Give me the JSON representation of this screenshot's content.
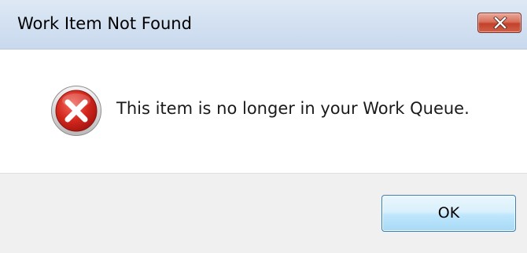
{
  "window": {
    "title": "Work Item Not Found",
    "close_icon": "close-x-icon"
  },
  "message": {
    "icon": "error-icon",
    "text": "This item is no longer in your Work Queue."
  },
  "buttons": {
    "ok_label": "OK"
  },
  "colors": {
    "title_bar": "#d3e1f1",
    "close_button": "#c3412a",
    "error_icon": "#c8201a",
    "footer": "#f0f0f0",
    "ok_button_border": "#3c7fb1"
  }
}
